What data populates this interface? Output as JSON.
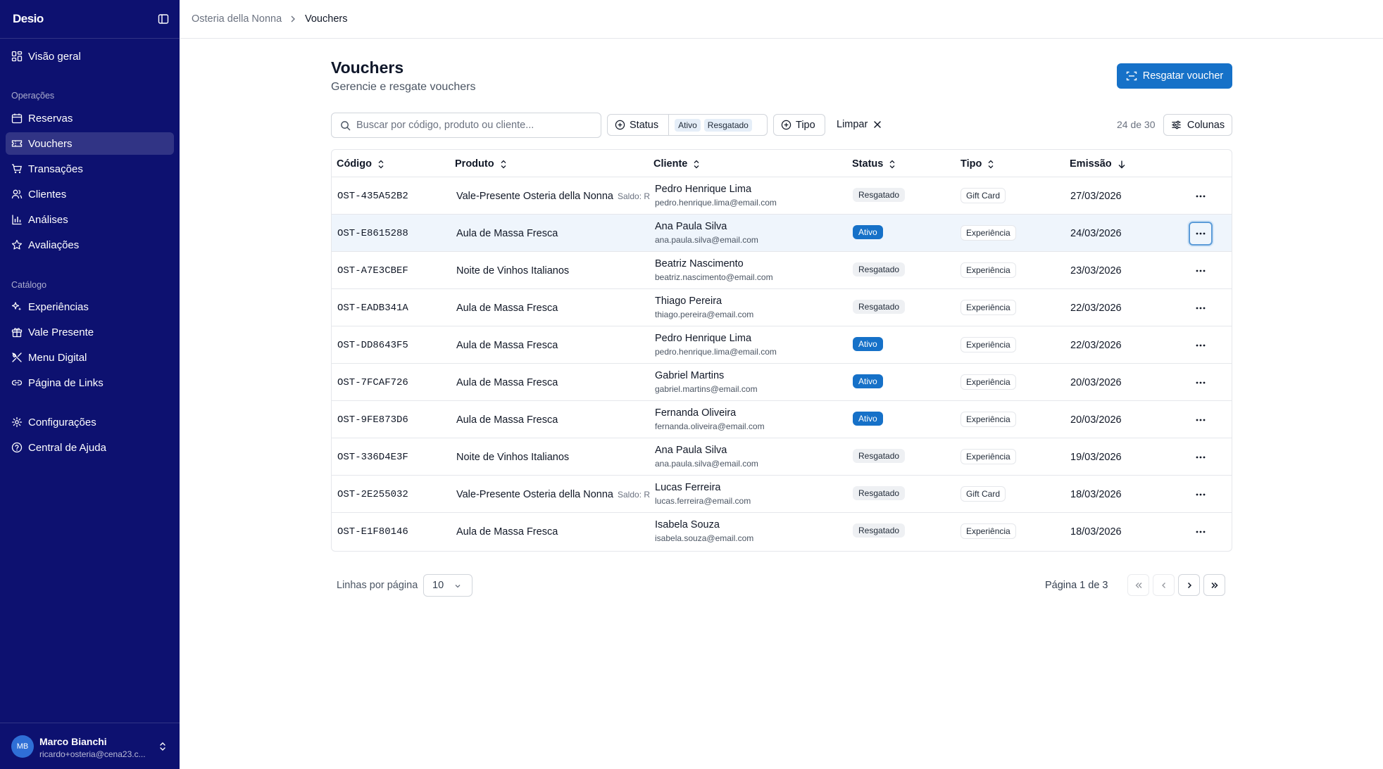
{
  "app": {
    "brand": "Desio"
  },
  "breadcrumb": {
    "parent": "Osteria della Nonna",
    "current": "Vouchers"
  },
  "sidebar": {
    "items": [
      {
        "label": "Visão geral",
        "icon": "dashboard-icon"
      },
      {
        "label": "Reservas",
        "icon": "calendar-icon"
      },
      {
        "label": "Vouchers",
        "icon": "ticket-icon",
        "active": true
      },
      {
        "label": "Transações",
        "icon": "cart-icon"
      },
      {
        "label": "Clientes",
        "icon": "users-icon"
      },
      {
        "label": "Análises",
        "icon": "bar-chart-icon"
      },
      {
        "label": "Avaliações",
        "icon": "star-icon"
      },
      {
        "label": "Experiências",
        "icon": "sparkles-icon"
      },
      {
        "label": "Vale Presente",
        "icon": "gift-icon"
      },
      {
        "label": "Menu Digital",
        "icon": "utensils-icon"
      },
      {
        "label": "Página de Links",
        "icon": "link-icon"
      },
      {
        "label": "Configurações",
        "icon": "gear-icon"
      },
      {
        "label": "Central de Ajuda",
        "icon": "help-icon"
      }
    ],
    "sections": {
      "operations": "Operações",
      "catalog": "Catálogo"
    },
    "user": {
      "initials": "MB",
      "name": "Marco Bianchi",
      "email": "ricardo+osteria@cena23.c..."
    }
  },
  "header": {
    "title": "Vouchers",
    "subtitle": "Gerencie e resgate vouchers",
    "redeem_button": "Resgatar voucher"
  },
  "toolbar": {
    "search_placeholder": "Buscar por código, produto ou cliente...",
    "status_filter": "Status",
    "status_chips": [
      "Ativo",
      "Resgatado"
    ],
    "type_filter": "Tipo",
    "clear": "Limpar",
    "count": "24 de 30",
    "columns": "Colunas"
  },
  "table": {
    "headers": [
      "Código",
      "Produto",
      "Cliente",
      "Status",
      "Tipo",
      "Emissão"
    ],
    "rows": [
      {
        "code": "OST-435A52B2",
        "product": "Vale-Presente Osteria della Nonna",
        "saldo": "Saldo: R",
        "client": "Pedro Henrique Lima",
        "email": "pedro.henrique.lima@email.com",
        "status": "Resgatado",
        "type": "Gift Card",
        "date": "27/03/2026"
      },
      {
        "code": "OST-E8615288",
        "product": "Aula de Massa Fresca",
        "saldo": "",
        "client": "Ana Paula Silva",
        "email": "ana.paula.silva@email.com",
        "status": "Ativo",
        "type": "Experiência",
        "date": "24/03/2026"
      },
      {
        "code": "OST-A7E3CBEF",
        "product": "Noite de Vinhos Italianos",
        "saldo": "",
        "client": "Beatriz Nascimento",
        "email": "beatriz.nascimento@email.com",
        "status": "Resgatado",
        "type": "Experiência",
        "date": "23/03/2026"
      },
      {
        "code": "OST-EADB341A",
        "product": "Aula de Massa Fresca",
        "saldo": "",
        "client": "Thiago Pereira",
        "email": "thiago.pereira@email.com",
        "status": "Resgatado",
        "type": "Experiência",
        "date": "22/03/2026"
      },
      {
        "code": "OST-DD8643F5",
        "product": "Aula de Massa Fresca",
        "saldo": "",
        "client": "Pedro Henrique Lima",
        "email": "pedro.henrique.lima@email.com",
        "status": "Ativo",
        "type": "Experiência",
        "date": "22/03/2026"
      },
      {
        "code": "OST-7FCAF726",
        "product": "Aula de Massa Fresca",
        "saldo": "",
        "client": "Gabriel Martins",
        "email": "gabriel.martins@email.com",
        "status": "Ativo",
        "type": "Experiência",
        "date": "20/03/2026"
      },
      {
        "code": "OST-9FE873D6",
        "product": "Aula de Massa Fresca",
        "saldo": "",
        "client": "Fernanda Oliveira",
        "email": "fernanda.oliveira@email.com",
        "status": "Ativo",
        "type": "Experiência",
        "date": "20/03/2026"
      },
      {
        "code": "OST-336D4E3F",
        "product": "Noite de Vinhos Italianos",
        "saldo": "",
        "client": "Ana Paula Silva",
        "email": "ana.paula.silva@email.com",
        "status": "Resgatado",
        "type": "Experiência",
        "date": "19/03/2026"
      },
      {
        "code": "OST-2E255032",
        "product": "Vale-Presente Osteria della Nonna",
        "saldo": "Saldo: R",
        "client": "Lucas Ferreira",
        "email": "lucas.ferreira@email.com",
        "status": "Resgatado",
        "type": "Gift Card",
        "date": "18/03/2026"
      },
      {
        "code": "OST-E1F80146",
        "product": "Aula de Massa Fresca",
        "saldo": "",
        "client": "Isabela Souza",
        "email": "isabela.souza@email.com",
        "status": "Resgatado",
        "type": "Experiência",
        "date": "18/03/2026"
      }
    ]
  },
  "pagination": {
    "rows_label": "Linhas por página",
    "rows_value": "10",
    "page_label": "Página 1 de 3"
  },
  "colors": {
    "sidebar": "#0d1170",
    "accent": "#1671c8"
  }
}
